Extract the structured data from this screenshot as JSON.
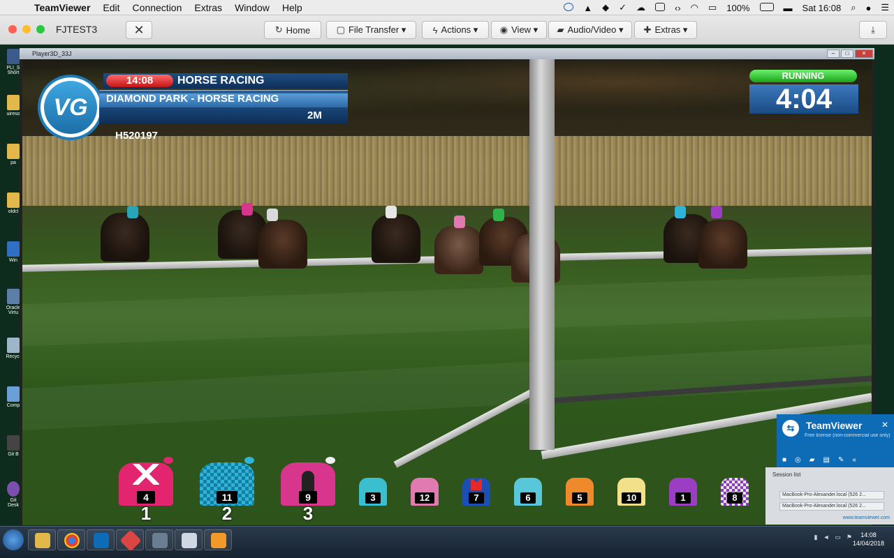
{
  "menubar": {
    "app_name": "TeamViewer",
    "items": [
      "Edit",
      "Connection",
      "Extras",
      "Window",
      "Help"
    ],
    "battery": "100%",
    "clock": "Sat 16:08"
  },
  "toolbar": {
    "session_name": "FJTEST3",
    "buttons": [
      {
        "label": "Home",
        "icon": "home-icon"
      },
      {
        "label": "File Transfer ▾",
        "icon": "file-transfer-icon"
      },
      {
        "label": "Actions ▾",
        "icon": "lightning-icon"
      },
      {
        "label": "View ▾",
        "icon": "eye-icon"
      },
      {
        "label": "Audio/Video ▾",
        "icon": "chat-icon"
      },
      {
        "label": "Extras ▾",
        "icon": "puzzle-icon"
      }
    ]
  },
  "remote": {
    "game_window_title": "Player3D_33J",
    "hud": {
      "logo": "VG",
      "race_time": "14:08",
      "category": "HORSE RACING",
      "venue": "DIAMOND PARK - HORSE RACING",
      "distance": "2M",
      "race_id": "H520197",
      "status": "RUNNING",
      "countdown": "4:04"
    },
    "silks": [
      {
        "number": "4",
        "position": "1",
        "color": "#e3246e",
        "accent": "#ffffff"
      },
      {
        "number": "11",
        "position": "2",
        "color": "#2fb3d6",
        "accent": "#147ea3"
      },
      {
        "number": "9",
        "position": "3",
        "color": "#d8368c",
        "accent": "#222222"
      },
      {
        "number": "3",
        "color": "#39bfcf",
        "accent": "#ffffff"
      },
      {
        "number": "12",
        "color": "#e07ab0",
        "accent": "#3caa3c"
      },
      {
        "number": "7",
        "color": "#1b4fb5",
        "accent": "#e52828"
      },
      {
        "number": "6",
        "color": "#58c7d9",
        "accent": "#e27aa9"
      },
      {
        "number": "5",
        "color": "#ee8a2c",
        "accent": "#2eb34b"
      },
      {
        "number": "10",
        "color": "#f2e08a",
        "accent": "#222222"
      },
      {
        "number": "1",
        "color": "#9c3ec4",
        "accent": "#2fb3d6"
      },
      {
        "number": "8",
        "color": "#e6e6e6",
        "accent": "#8a3cbf"
      }
    ],
    "teamviewer_popup": {
      "title": "TeamViewer",
      "subtitle": "Free license (non-commercial use only)",
      "session_list_label": "Session list",
      "sessions": [
        "MacBook-Pro-Alexander.local (526 2...",
        "MacBook-Pro-Alexander.local (526 2..."
      ],
      "footer_link": "www.teamviewer.com"
    },
    "taskbar": {
      "time": "14:08",
      "date": "14/04/2018"
    },
    "desktop_icons": [
      "PLI_S Short",
      "uireso",
      "pa",
      "oldcl",
      "Win",
      "Oracle Virtu",
      "Recycl",
      "Comp",
      "Git B",
      "Git Desk"
    ]
  },
  "colors": {
    "hud_blue": "#174374",
    "running_green": "#1aa41a",
    "time_red": "#c11616",
    "teamviewer_blue": "#0e6cb6"
  }
}
